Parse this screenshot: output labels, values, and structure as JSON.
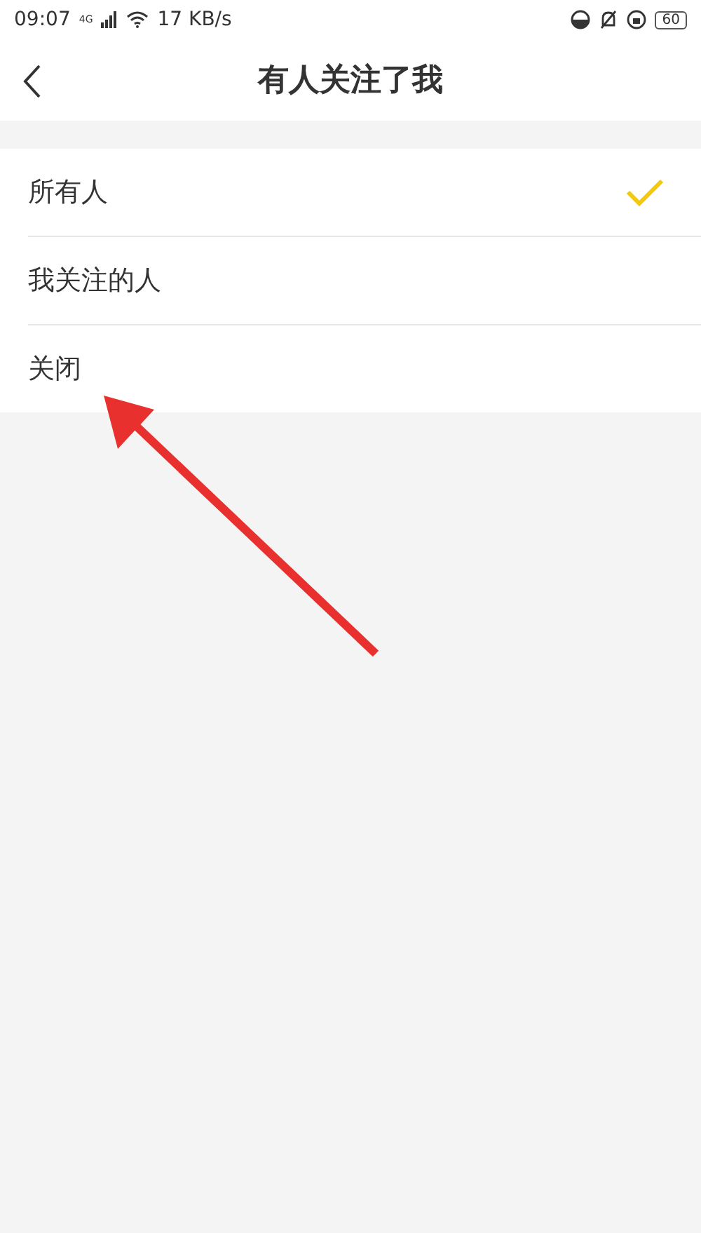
{
  "status_bar": {
    "time": "09:07",
    "network": "4G",
    "speed": "17 KB/s",
    "battery": "60"
  },
  "header": {
    "title": "有人关注了我"
  },
  "options": [
    {
      "label": "所有人",
      "selected": true
    },
    {
      "label": "我关注的人",
      "selected": false
    },
    {
      "label": "关闭",
      "selected": false
    }
  ],
  "annotation": {
    "kind": "arrow"
  }
}
